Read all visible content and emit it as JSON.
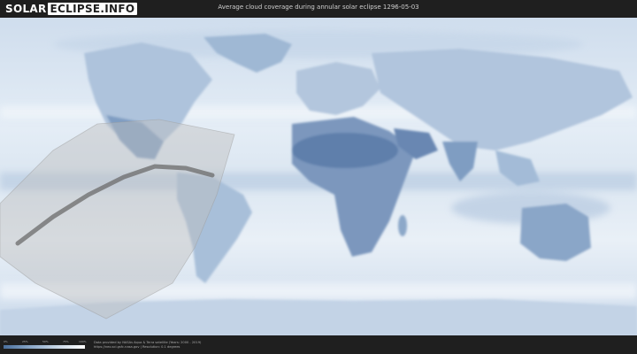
{
  "header": {
    "logo_left": "SOLAR",
    "logo_right": "ECLIPSE.INFO",
    "title": "Average cloud coverage during annular solar eclipse 1296-05-03"
  },
  "map": {
    "kind": "world cloud coverage map",
    "eclipse_path_color": "#bfbfbf",
    "centerline_color": "#6b6b6b"
  },
  "legend": {
    "tick_labels": [
      "0%",
      "25%",
      "50%",
      "75%",
      "100%"
    ],
    "colors": [
      "#4a6f9c",
      "#8aa7c7",
      "#c9d7e6",
      "#ffffff"
    ]
  },
  "footer": {
    "credit_line_1": "Data provided by NASAs Aqua & Terra satellite (Years: 2000 - 2019)",
    "credit_line_2": "https://neo.sci.gsfc.nasa.gov  |  Resolution: 0.1 degrees"
  }
}
